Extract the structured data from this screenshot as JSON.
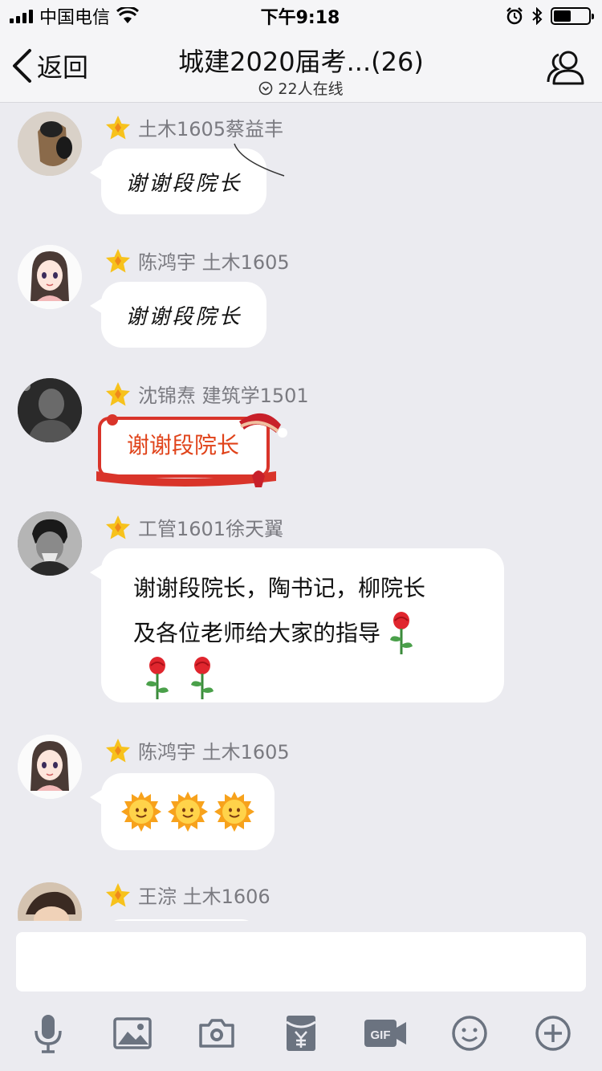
{
  "status_bar": {
    "carrier": "中国电信",
    "time": "下午9:18",
    "battery_level": 0.5
  },
  "nav": {
    "back_label": "返回",
    "title": "城建2020届考...(26)",
    "online": "22人在线"
  },
  "messages": [
    {
      "sender": "土木1605蔡益丰",
      "text": "谢谢段院长",
      "style": "handwriting"
    },
    {
      "sender": "陈鸿宇 土木1605",
      "text": "谢谢段院长",
      "style": "handwriting"
    },
    {
      "sender": "沈锦焘 建筑学1501",
      "text": "谢谢段院长",
      "style": "festive"
    },
    {
      "sender": "工管1601徐天翼",
      "line1": "谢谢段院长，陶书记，柳院长",
      "line2": "及各位老师给大家的指导",
      "emoji": [
        "rose-icon",
        "rose-icon",
        "rose-icon"
      ]
    },
    {
      "sender": "陈鸿宇 土木1605",
      "emoji": [
        "sun-icon",
        "sun-icon",
        "sun-icon"
      ]
    },
    {
      "sender": "王淙 土木1606"
    }
  ],
  "input": {
    "placeholder": ""
  },
  "toolbar_icons": [
    "microphone-icon",
    "image-icon",
    "camera-icon",
    "red-packet-icon",
    "gif-icon",
    "emoji-icon",
    "plus-icon"
  ],
  "colors": {
    "background": "#ebebf0",
    "bubble": "#ffffff",
    "sender_text": "#7a7a80",
    "star": "#f7c21c",
    "festive_text": "#e0431a",
    "icon": "#6b7380"
  }
}
